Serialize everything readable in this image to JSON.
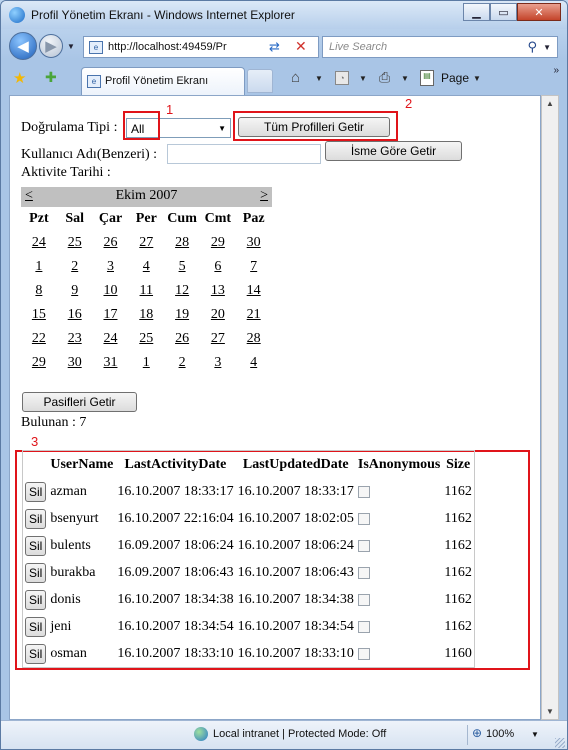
{
  "window": {
    "title": "Profil Yönetim Ekranı - Windows Internet Explorer",
    "minimize": "▁",
    "maximize": "▭",
    "close": "✕"
  },
  "nav": {
    "address": "http://localhost:49459/Pr",
    "search_placeholder": "Live Search"
  },
  "tab": {
    "label": "Profil Yönetim Ekranı"
  },
  "toolbar": {
    "page_label": "Page"
  },
  "form": {
    "auth_label": "Doğrulama Tipi :",
    "auth_selected": "All",
    "get_all_button": "Tüm Profilleri Getir",
    "username_label": "Kullanıcı Adı(Benzeri) :",
    "username_value": "",
    "by_name_button": "İsme Göre Getir",
    "activity_label": "Aktivite Tarihi :",
    "inactive_button": "Pasifleri Getir",
    "found_text": "Bulunan : 7"
  },
  "calendar": {
    "prev": "<",
    "next": ">",
    "month": "Ekim 2007",
    "days_of_week": [
      "Pzt",
      "Sal",
      "Çar",
      "Per",
      "Cum",
      "Cmt",
      "Paz"
    ],
    "weeks": [
      [
        "24",
        "25",
        "26",
        "27",
        "28",
        "29",
        "30"
      ],
      [
        "1",
        "2",
        "3",
        "4",
        "5",
        "6",
        "7"
      ],
      [
        "8",
        "9",
        "10",
        "11",
        "12",
        "13",
        "14"
      ],
      [
        "15",
        "16",
        "17",
        "18",
        "19",
        "20",
        "21"
      ],
      [
        "22",
        "23",
        "24",
        "25",
        "26",
        "27",
        "28"
      ],
      [
        "29",
        "30",
        "31",
        "1",
        "2",
        "3",
        "4"
      ]
    ]
  },
  "annotations": {
    "n1": "1",
    "n2": "2",
    "n3": "3"
  },
  "grid": {
    "headers": [
      "",
      "UserName",
      "LastActivityDate",
      "LastUpdatedDate",
      "IsAnonymous",
      "Size"
    ],
    "delete_label": "Sil",
    "rows": [
      {
        "user": "azman",
        "activity": "16.10.2007 18:33:17",
        "updated": "16.10.2007 18:33:17",
        "size": "1162"
      },
      {
        "user": "bsenyurt",
        "activity": "16.10.2007 22:16:04",
        "updated": "16.10.2007 18:02:05",
        "size": "1162"
      },
      {
        "user": "bulents",
        "activity": "16.09.2007 18:06:24",
        "updated": "16.10.2007 18:06:24",
        "size": "1162"
      },
      {
        "user": "burakba",
        "activity": "16.09.2007 18:06:43",
        "updated": "16.10.2007 18:06:43",
        "size": "1162"
      },
      {
        "user": "donis",
        "activity": "16.10.2007 18:34:38",
        "updated": "16.10.2007 18:34:38",
        "size": "1162"
      },
      {
        "user": "jeni",
        "activity": "16.10.2007 18:34:54",
        "updated": "16.10.2007 18:34:54",
        "size": "1162"
      },
      {
        "user": "osman",
        "activity": "16.10.2007 18:33:10",
        "updated": "16.10.2007 18:33:10",
        "size": "1160"
      }
    ]
  },
  "status": {
    "zone": "Local intranet | Protected Mode: Off",
    "zoom": "100%"
  }
}
